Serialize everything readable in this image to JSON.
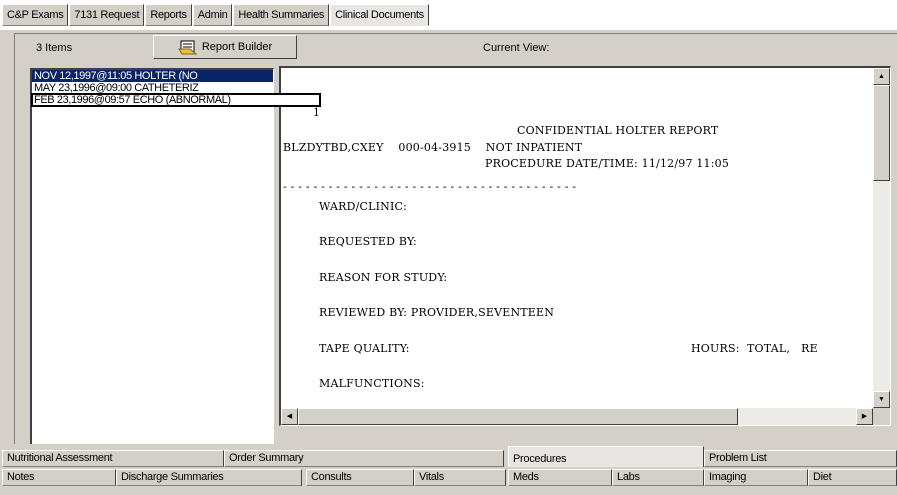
{
  "top_tabs": [
    {
      "label": "C&P Exams",
      "active": false
    },
    {
      "label": "7131 Request",
      "active": false
    },
    {
      "label": "Reports",
      "active": false
    },
    {
      "label": "Admin",
      "active": false
    },
    {
      "label": "Health Summaries",
      "active": false
    },
    {
      "label": "Clinical Documents",
      "active": true
    }
  ],
  "toolbar": {
    "items_count": "3 Items",
    "report_builder_label": "Report Builder",
    "report_builder_icon": "report-builder-icon",
    "current_view_label": "Current View:"
  },
  "list": {
    "items": [
      {
        "label": "NOV 12,1997@11:05  HOLTER  (NO",
        "selected": true,
        "focused": false
      },
      {
        "label": "MAY 23,1996@09:00  CATHETERIZ",
        "selected": false,
        "focused": false
      },
      {
        "label": "FEB 23,1996@09:57  ECHO  (ABNORMAL)",
        "selected": false,
        "focused": true
      }
    ]
  },
  "report": {
    "page_num": "1",
    "title": "CONFIDENTIAL HOLTER REPORT",
    "patient_line": "BLZDYTBD,CXEY    000-04-3915    NOT INPATIENT",
    "proc_line": "PROCEDURE DATE/TIME: 11/12/97 11:05",
    "dash_line": "- - - - - - - - - - - - - - - - - - - - - - - - - - - - - - - - - - - - - - -",
    "fields": [
      "WARD/CLINIC:",
      "REQUESTED BY:",
      "REASON FOR STUDY:",
      "REVIEWED BY: PROVIDER,SEVENTEEN",
      "TAPE QUALITY:",
      "MALFUNCTIONS:"
    ],
    "hours_text": "HOURS:  TOTAL,   RE"
  },
  "bottom_tabs_row1": [
    {
      "label": "Nutritional Assessment",
      "active": false
    },
    {
      "label": "Order Summary",
      "active": false
    },
    {
      "label": "Procedures",
      "active": true
    },
    {
      "label": "Problem List",
      "active": false
    }
  ],
  "bottom_tabs_row2": [
    {
      "label": "Notes"
    },
    {
      "label": "Discharge Summaries"
    },
    {
      "label": "Consults"
    },
    {
      "label": "Vitals"
    },
    {
      "label": "Meds"
    },
    {
      "label": "Labs"
    },
    {
      "label": "Imaging"
    },
    {
      "label": "Diet"
    }
  ],
  "colors": {
    "selection": "#0a246a",
    "face": "#d4d0c8"
  }
}
